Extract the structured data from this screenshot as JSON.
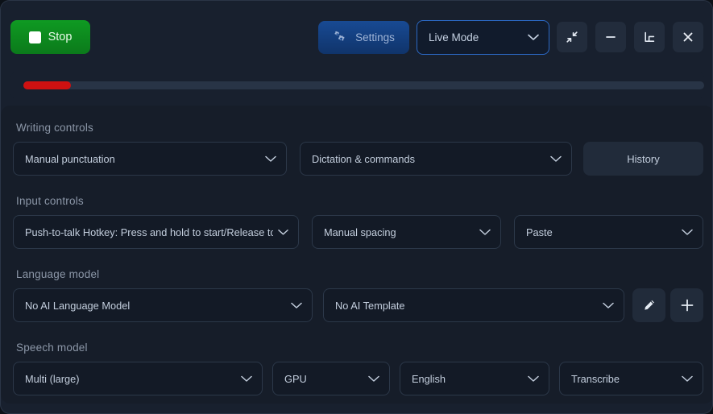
{
  "toolbar": {
    "stop_label": "Stop",
    "stop_icon": "stop-square-icon",
    "settings_label": "Settings",
    "settings_icon": "gears-icon",
    "mode_value": "Live Mode",
    "mode_chevron_icon": "chevron-down-icon",
    "window_buttons": [
      {
        "name": "collapse-window-button",
        "icon": "collapse-diagonal-icon"
      },
      {
        "name": "minimize-window-button",
        "icon": "minimize-dash-icon"
      },
      {
        "name": "dock-window-button",
        "icon": "dock-corner-icon"
      },
      {
        "name": "close-window-button",
        "icon": "close-x-icon"
      }
    ]
  },
  "level_meter": {
    "fill_percent": 7,
    "fill_color": "#cf1111",
    "track_color": "#283446"
  },
  "sections": {
    "writing_controls": {
      "label": "Writing controls",
      "punctuation_value": "Manual punctuation",
      "dictation_value": "Dictation & commands",
      "history_label": "History"
    },
    "input_controls": {
      "label": "Input controls",
      "hotkey_value": "Push-to-talk Hotkey: Press and hold to start/Release to stop",
      "spacing_value": "Manual spacing",
      "paste_value": "Paste"
    },
    "language_model": {
      "label": "Language model",
      "model_value": "No AI Language Model",
      "template_value": "No AI Template",
      "edit_icon": "pencil-icon",
      "add_icon": "plus-icon"
    },
    "speech_model": {
      "label": "Speech model",
      "model_value": "Multi (large)",
      "device_value": "GPU",
      "language_value": "English",
      "task_value": "Transcribe"
    }
  },
  "colors": {
    "window_bg": "#18202e",
    "panel_bg": "#161d29",
    "control_bg": "#131a26",
    "control_border": "#2c3849",
    "accent_blue": "#2b68c4",
    "stop_green": "#0f9a22",
    "text_primary": "#c3cedd",
    "text_muted": "#8c97a8"
  }
}
